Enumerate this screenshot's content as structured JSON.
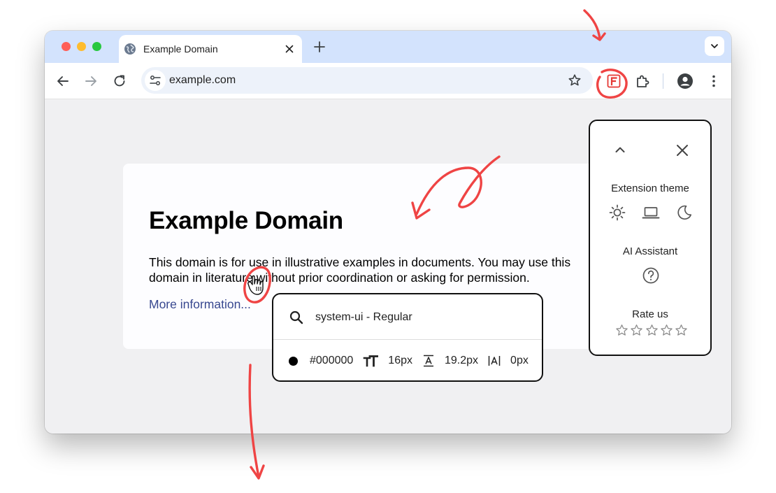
{
  "browser": {
    "tab_title": "Example Domain",
    "url": "example.com"
  },
  "page": {
    "title": "Example Domain",
    "paragraph": "This domain is for use in illustrative examples in documents. You may use this domain in literature without prior coordination or asking for permission.",
    "link_text": "More information..."
  },
  "inspector": {
    "font": "system-ui - Regular",
    "color": "#000000",
    "font_size": "16px",
    "line_height": "19.2px",
    "letter_spacing": "0px"
  },
  "panel": {
    "theme_heading": "Extension theme",
    "ai_heading": "AI Assistant",
    "rate_heading": "Rate us",
    "star_count": 5,
    "rating": 0
  },
  "colors": {
    "tabstrip": "#d3e3fd",
    "omnibox": "#edf2fa",
    "annotation": "#ef4444",
    "link": "#38488f",
    "extension_icon": "#e53935"
  },
  "icons": {
    "tab_favicon": "globe-icon",
    "close": "close-icon",
    "new_tab": "plus-icon",
    "tab_search": "chevron-down-icon",
    "back": "arrow-left-icon",
    "forward": "arrow-right-icon",
    "reload": "reload-icon",
    "site_info": "tune-icon",
    "bookmark": "star-icon",
    "extension": "fonts-f-icon",
    "extensions_menu": "puzzle-icon",
    "profile": "avatar-icon",
    "menu": "kebab-icon",
    "search": "search-icon",
    "font_size": "text-size-icon",
    "line_height": "line-height-icon",
    "letter_spacing": "letter-spacing-icon",
    "collapse": "chevron-up-icon",
    "theme_light": "sun-icon",
    "theme_system": "laptop-icon",
    "theme_dark": "moon-icon",
    "help": "help-circle-icon",
    "cursor": "hand-pointer-icon"
  }
}
